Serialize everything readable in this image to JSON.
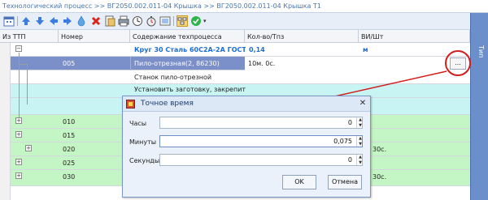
{
  "breadcrumb": "Технологический процесс >> ВГ2050.002.011-04 Крышка >> ВГ2050.002.011-04 Крышка Т1",
  "right_panel_tab": "Тип",
  "toolbar": {
    "icons": [
      "calendar-icon",
      "arrow-up-icon",
      "arrow-down-icon",
      "arrow-left-icon",
      "arrow-right-icon",
      "drop-icon",
      "delete-icon",
      "document-icon",
      "printer-icon",
      "clock-icon",
      "timer-icon",
      "list-icon",
      "hierarchy-icon",
      "check-icon"
    ],
    "dropdown": "▾"
  },
  "grid": {
    "columns": [
      "Из ТТП",
      "Номер",
      "Содержание техпроцесса",
      "Кол-во/Тпз",
      "ВИ/Шт"
    ],
    "rows": [
      {
        "num": "",
        "content": "Круг 30 Сталь 60С2А-2А ГОСТ 1...",
        "qty": "0,14",
        "unit": "м",
        "style": "material"
      },
      {
        "num": "005",
        "content": "Пило-отрезная(2, 86230)",
        "qty": "10м. 0с.",
        "unit": "",
        "style": "selected"
      },
      {
        "num": "",
        "content": "Станок пило-отрезной",
        "qty": "",
        "unit": "",
        "style": "white"
      },
      {
        "num": "",
        "content": "Установить заготовку, закрепить",
        "qty": "",
        "unit": "",
        "style": "cyan"
      },
      {
        "num": "",
        "content": "",
        "qty": "",
        "unit": "",
        "style": "cyan"
      },
      {
        "num": "010",
        "content": "",
        "qty": "",
        "unit": "",
        "style": "green"
      },
      {
        "num": "015",
        "content": "",
        "qty": "",
        "unit": "",
        "style": "green"
      },
      {
        "num": "020",
        "content": "",
        "qty": "",
        "unit": "30с.",
        "style": "green"
      },
      {
        "num": "025",
        "content": "",
        "qty": "",
        "unit": "",
        "style": "green"
      },
      {
        "num": "030",
        "content": "",
        "qty": "",
        "unit": "30с.",
        "style": "green"
      }
    ],
    "ellipsis_label": "..."
  },
  "dialog": {
    "title": "Точное время",
    "fields": [
      {
        "label": "Часы",
        "value": "0"
      },
      {
        "label": "Минуты",
        "value": "0,075"
      },
      {
        "label": "Секунды",
        "value": "0"
      }
    ],
    "ok": "OK",
    "cancel": "Отмена"
  },
  "colors": {
    "selected_row": "#7b8fc9",
    "green_row": "#c4f5c4",
    "cyan_row": "#c8f4f4",
    "annotation": "#d51c1c",
    "accent_blue": "#1a6dd6"
  }
}
